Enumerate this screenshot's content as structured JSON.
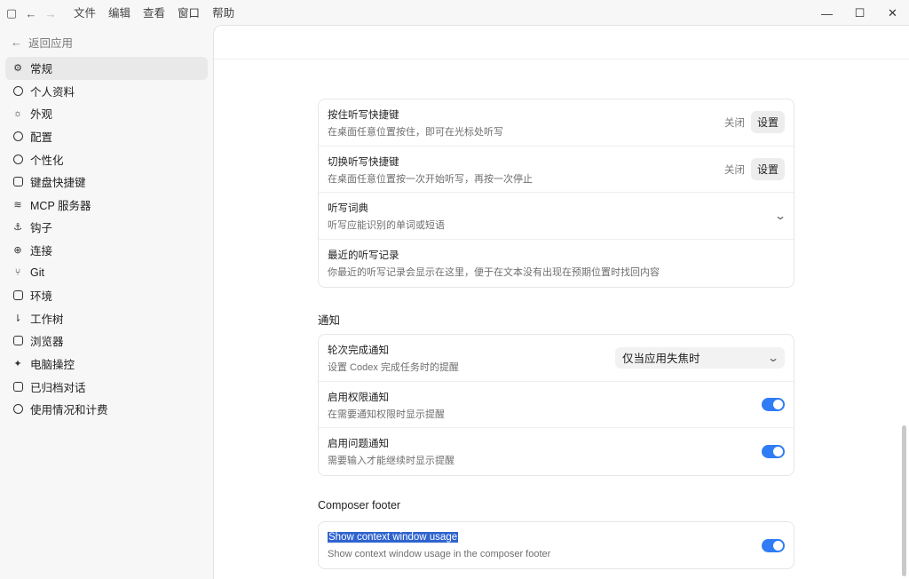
{
  "titlebar": {
    "menus": [
      "文件",
      "编辑",
      "查看",
      "窗口",
      "帮助"
    ]
  },
  "sidebar": {
    "back_label": "返回应用",
    "items": [
      {
        "label": "常规",
        "icon": "gear-icon",
        "active": true
      },
      {
        "label": "个人资料",
        "icon": "person-icon"
      },
      {
        "label": "外观",
        "icon": "sun-icon"
      },
      {
        "label": "配置",
        "icon": "config-icon"
      },
      {
        "label": "个性化",
        "icon": "personalize-icon"
      },
      {
        "label": "键盘快捷键",
        "icon": "keyboard-icon"
      },
      {
        "label": "MCP 服务器",
        "icon": "mcp-icon"
      },
      {
        "label": "钩子",
        "icon": "hook-icon"
      },
      {
        "label": "连接",
        "icon": "globe-icon"
      },
      {
        "label": "Git",
        "icon": "git-branch-icon"
      },
      {
        "label": "环境",
        "icon": "environment-icon"
      },
      {
        "label": "工作树",
        "icon": "worktree-icon"
      },
      {
        "label": "浏览器",
        "icon": "browser-icon"
      },
      {
        "label": "电脑操控",
        "icon": "cursor-icon"
      },
      {
        "label": "已归档对话",
        "icon": "archive-icon"
      },
      {
        "label": "使用情况和计费",
        "icon": "gauge-icon"
      }
    ]
  },
  "dictation": {
    "hold_title": "按住听写快捷键",
    "hold_desc": "在桌面任意位置按住，即可在光标处听写",
    "hold_status": "关闭",
    "hold_button": "设置",
    "toggle_title": "切换听写快捷键",
    "toggle_desc": "在桌面任意位置按一次开始听写，再按一次停止",
    "toggle_status": "关闭",
    "toggle_button": "设置",
    "dict_title": "听写词典",
    "dict_desc": "听写应能识别的单词或短语",
    "recent_title": "最近的听写记录",
    "recent_desc": "你最近的听写记录会显示在这里，便于在文本没有出现在预期位置时找回内容"
  },
  "notifications": {
    "section_title": "通知",
    "turn_title": "轮次完成通知",
    "turn_desc": "设置 Codex 完成任务时的提醒",
    "turn_value": "仅当应用失焦时",
    "perm_title": "启用权限通知",
    "perm_desc": "在需要通知权限时显示提醒",
    "perm_on": true,
    "question_title": "启用问题通知",
    "question_desc": "需要输入才能继续时显示提醒",
    "question_on": true
  },
  "composer": {
    "section_title": "Composer footer",
    "usage_title": "Show context window usage",
    "usage_desc": "Show context window usage in the composer footer",
    "usage_on": true
  },
  "colors": {
    "accent": "#2f7cf6",
    "selection": "#2f63cf"
  }
}
